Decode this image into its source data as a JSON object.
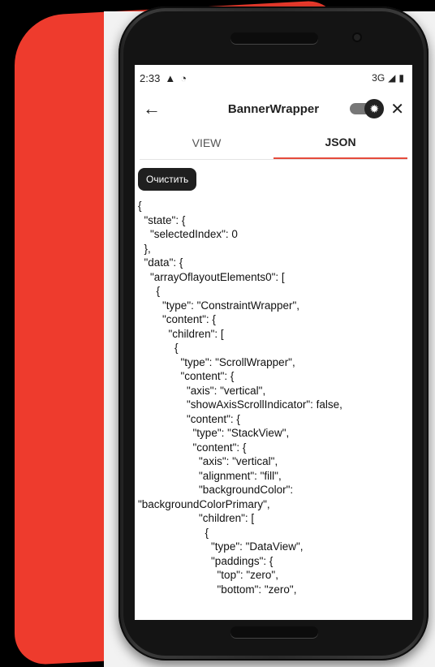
{
  "statusbar": {
    "time": "2:33",
    "network": "3G"
  },
  "toolbar": {
    "title": "BannerWrapper"
  },
  "tabs": [
    {
      "label": "VIEW"
    },
    {
      "label": "JSON"
    }
  ],
  "clear_button": "Очистить",
  "json_text": "{\n  \"state\": {\n    \"selectedIndex\": 0\n  },\n  \"data\": {\n    \"arrayOflayoutElements0\": [\n      {\n        \"type\": \"ConstraintWrapper\",\n        \"content\": {\n          \"children\": [\n            {\n              \"type\": \"ScrollWrapper\",\n              \"content\": {\n                \"axis\": \"vertical\",\n                \"showAxisScrollIndicator\": false,\n                \"content\": {\n                  \"type\": \"StackView\",\n                  \"content\": {\n                    \"axis\": \"vertical\",\n                    \"alignment\": \"fill\",\n                    \"backgroundColor\":\n\"backgroundColorPrimary\",\n                    \"children\": [\n                      {\n                        \"type\": \"DataView\",\n                        \"paddings\": {\n                          \"top\": \"zero\",\n                          \"bottom\": \"zero\","
}
